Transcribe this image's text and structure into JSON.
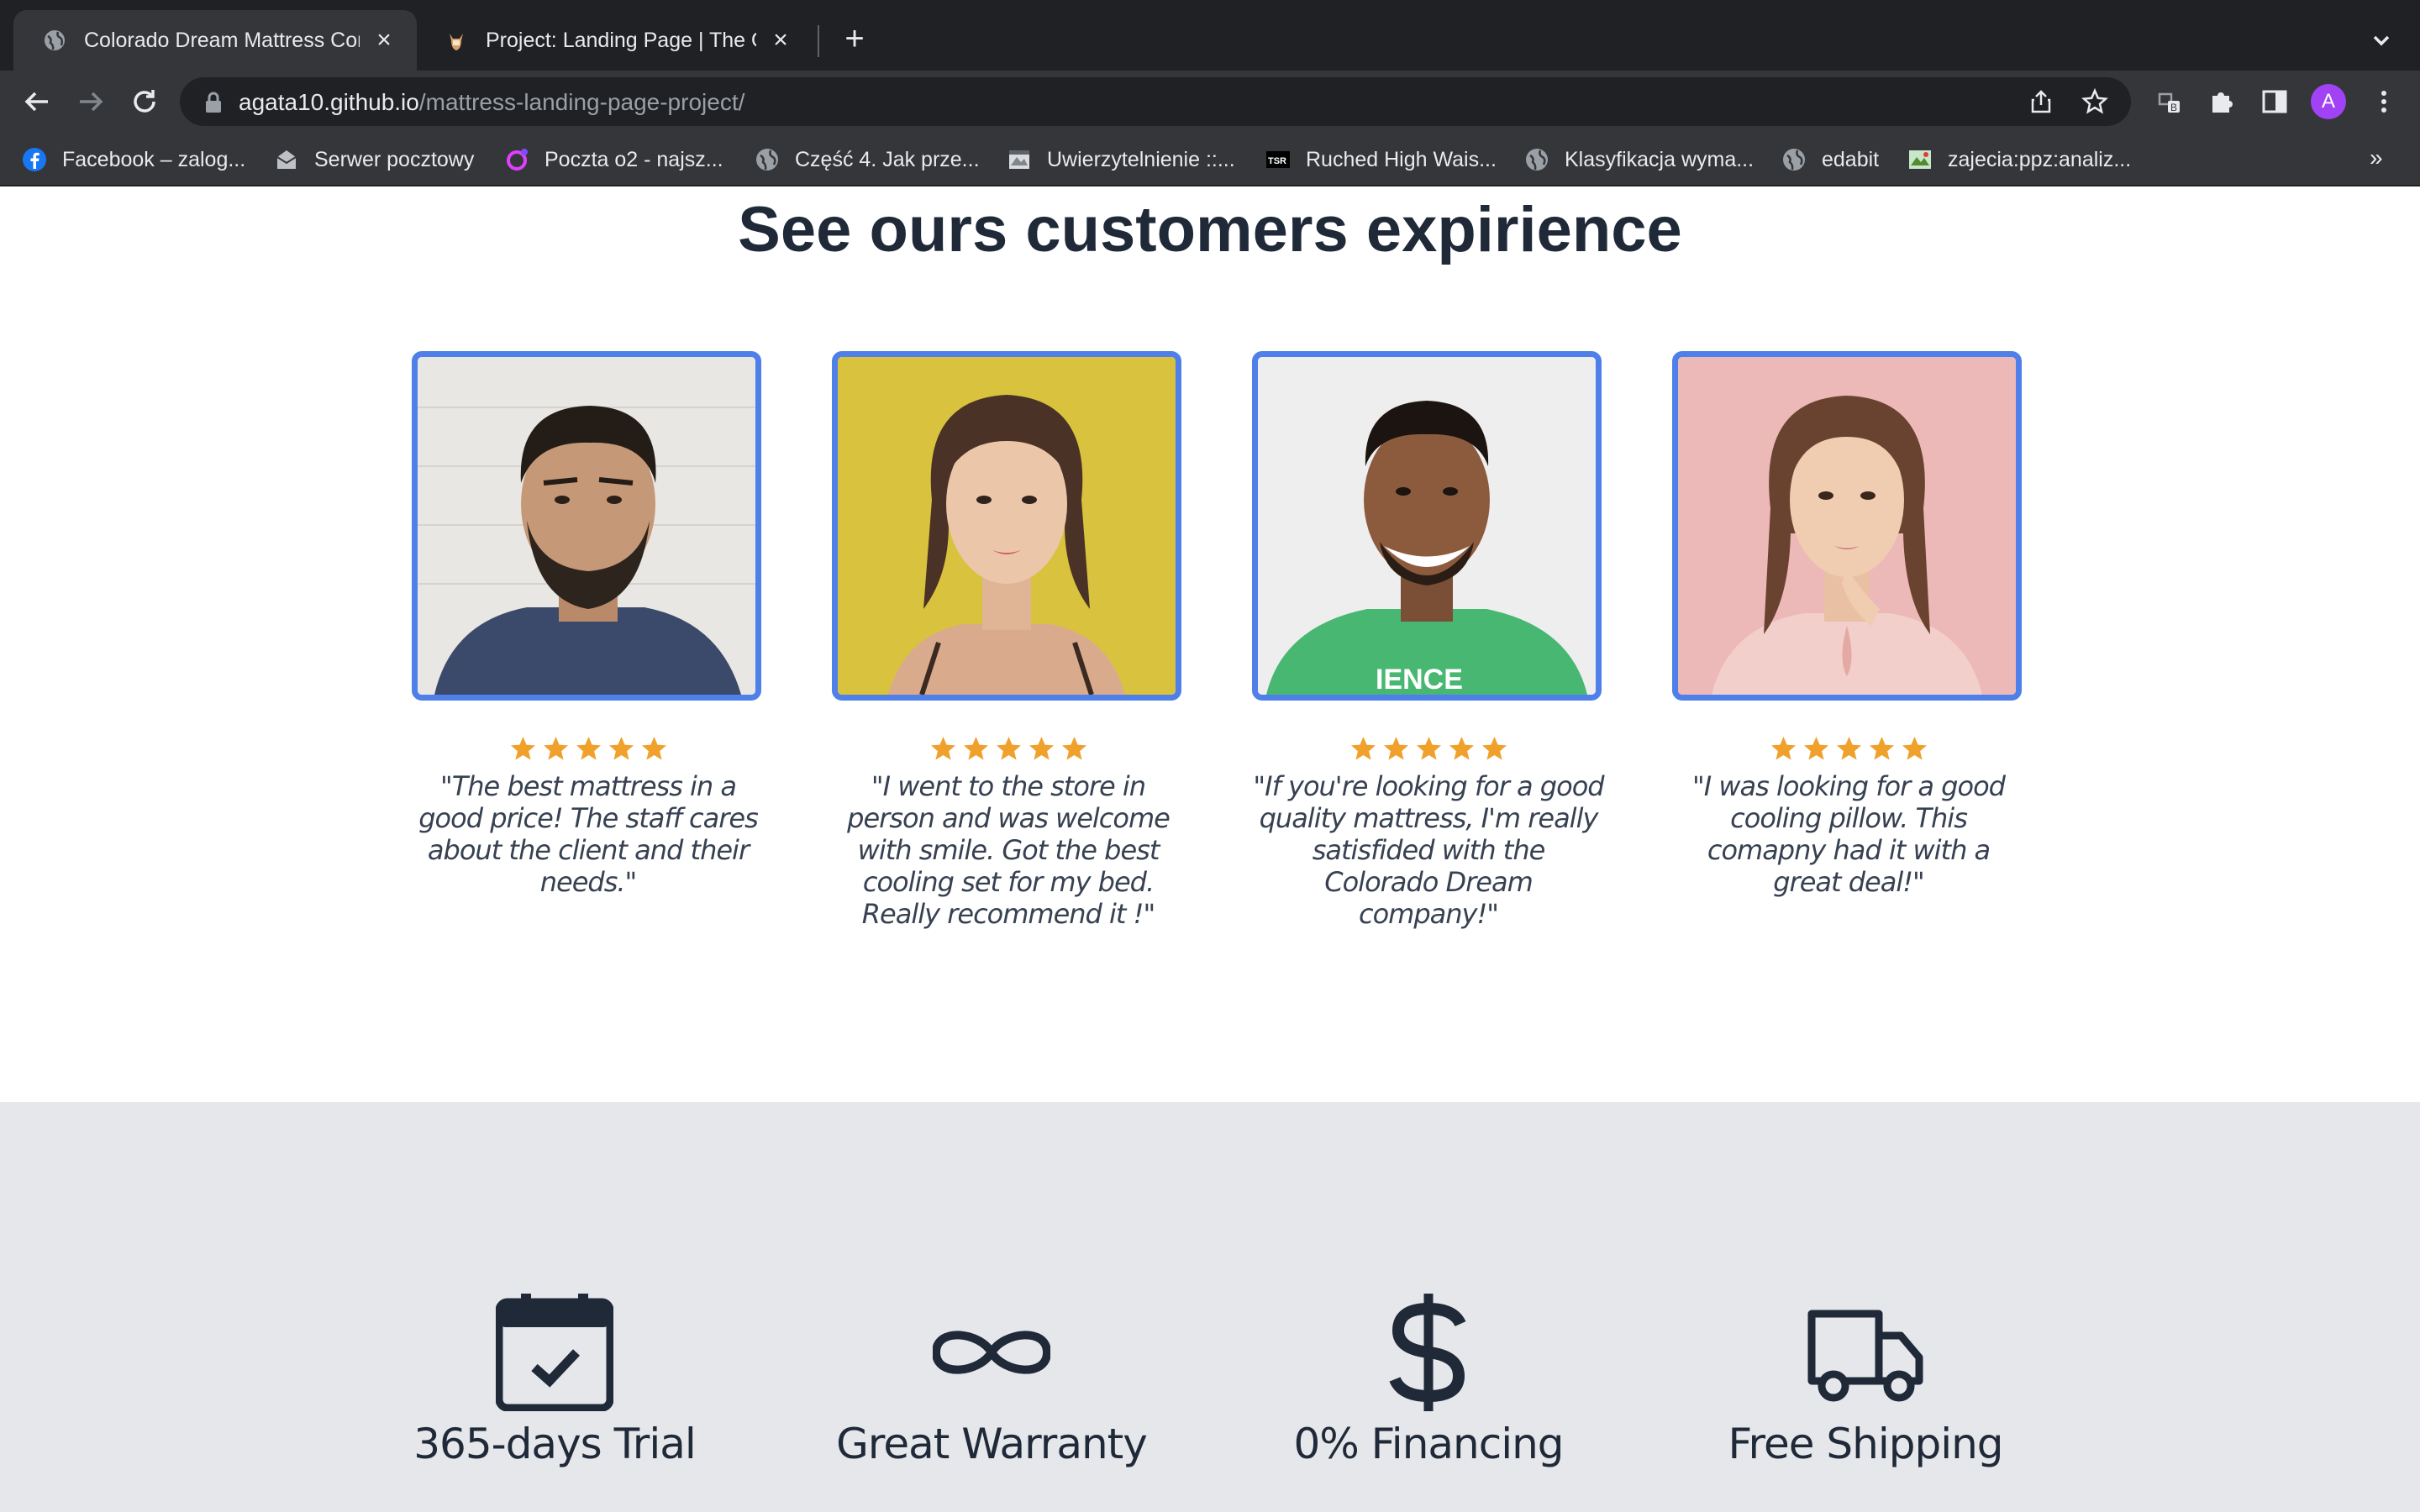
{
  "browser": {
    "tabs": [
      {
        "title": "Colorado Dream Mattress Com",
        "icon": "globe-icon",
        "active": true
      },
      {
        "title": "Project: Landing Page | The Od",
        "icon": "odin-icon",
        "active": false
      }
    ],
    "address": {
      "host": "agata10.github.io",
      "path": "/mattress-landing-page-project/"
    },
    "profile_initial": "A",
    "bookmarks": [
      {
        "label": "Facebook – zalog...",
        "icon": "facebook-icon"
      },
      {
        "label": "Serwer pocztowy",
        "icon": "mail-icon"
      },
      {
        "label": "Poczta o2 - najsz...",
        "icon": "o2-icon"
      },
      {
        "label": "Część 4. Jak prze...",
        "icon": "globe-icon"
      },
      {
        "label": "Uwierzytelnienie ::...",
        "icon": "auth-icon"
      },
      {
        "label": "Ruched High Wais...",
        "icon": "tsr-icon"
      },
      {
        "label": "Klasyfikacja wyma...",
        "icon": "globe-icon"
      },
      {
        "label": "edabit",
        "icon": "globe-icon"
      },
      {
        "label": "zajecia:ppz:analiz...",
        "icon": "wiki-icon"
      }
    ],
    "bookmarks_more": "»"
  },
  "testimonials": {
    "heading": "See ours customers expirience",
    "rating": 5,
    "colors": {
      "border": "#4f7fe8",
      "star": "#f0a12c"
    },
    "items": [
      {
        "quote": "\"The best mattress in a good price! The staff cares about the client and their needs.\"",
        "photo": "bearded-man-photo"
      },
      {
        "quote": "\"I went to the store in person and was welcome with smile. Got the best cooling set for my bed. Really recommend it !\"",
        "photo": "woman-yellow-background-photo"
      },
      {
        "quote": "\"If you're looking for a good quality mattress, I'm really satisfided with the Colorado Dream company!\"",
        "photo": "smiling-man-green-shirt-photo"
      },
      {
        "quote": "\"I was looking for a good cooling pillow. This comapny had it with a great deal!\"",
        "photo": "woman-pink-background-photo"
      }
    ]
  },
  "features": [
    {
      "label": "365-days Trial",
      "icon": "calendar-check-icon"
    },
    {
      "label": "Great Warranty",
      "icon": "infinity-icon"
    },
    {
      "label": "0% Financing",
      "icon": "dollar-icon"
    },
    {
      "label": "Free Shipping",
      "icon": "truck-icon"
    }
  ]
}
